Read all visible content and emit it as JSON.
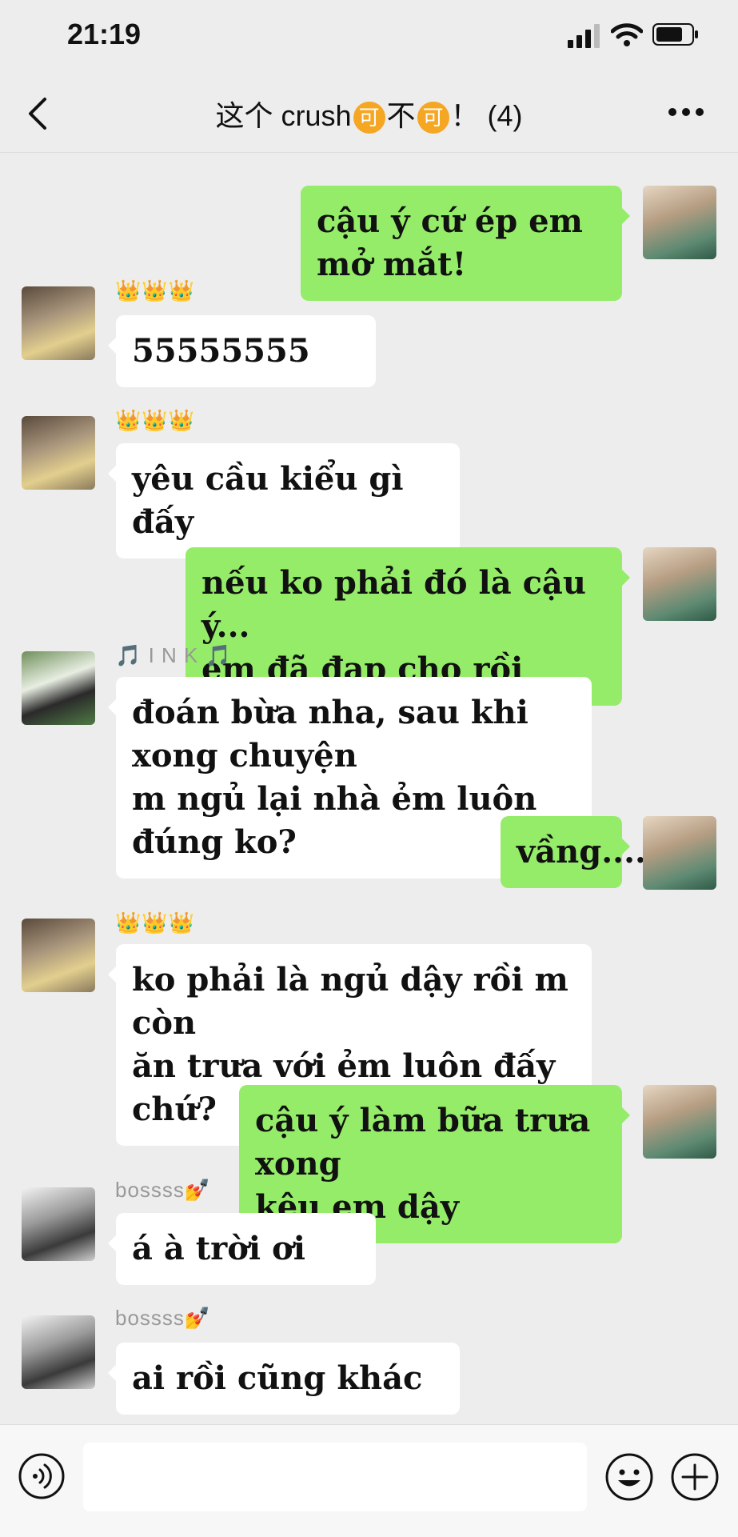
{
  "status": {
    "time": "21:19"
  },
  "nav": {
    "title_part1": "这个 crush",
    "title_ok1": "可",
    "title_mid": "不",
    "title_ok2": "可",
    "title_part2": "！ (4)"
  },
  "messages": [
    {
      "side": "right",
      "sender": "",
      "lines": [
        "cậu ý cứ ép em mở mắt!"
      ]
    },
    {
      "side": "left",
      "sender": "👑👑👑",
      "lines": [
        "55555555"
      ]
    },
    {
      "side": "left",
      "sender": "👑👑👑",
      "lines": [
        "yêu cầu kiểu gì đấy"
      ]
    },
    {
      "side": "right",
      "sender": "",
      "lines": [
        "nếu ko phải đó là cậu ý...",
        "em đã đạp cho rồi"
      ]
    },
    {
      "side": "left",
      "sender": "🎵 I N K 🎵",
      "lines": [
        "đoán bừa nha, sau khi xong chuyện",
        "m ngủ lại nhà ẻm luôn đúng ko?"
      ]
    },
    {
      "side": "right",
      "sender": "",
      "lines": [
        "vầng...."
      ]
    },
    {
      "side": "left",
      "sender": "👑👑👑",
      "lines": [
        "ko phải là ngủ dậy rồi m còn",
        "ăn trưa với ẻm luôn đấy chứ?"
      ]
    },
    {
      "side": "right",
      "sender": "",
      "lines": [
        "cậu ý làm bữa trưa xong",
        "kêu em dậy"
      ]
    },
    {
      "side": "left",
      "sender": "bossss💅",
      "lines": [
        "á à trời ơi"
      ]
    },
    {
      "side": "left",
      "sender": "bossss💅",
      "lines": [
        "ai rồi cũng khác"
      ]
    }
  ]
}
